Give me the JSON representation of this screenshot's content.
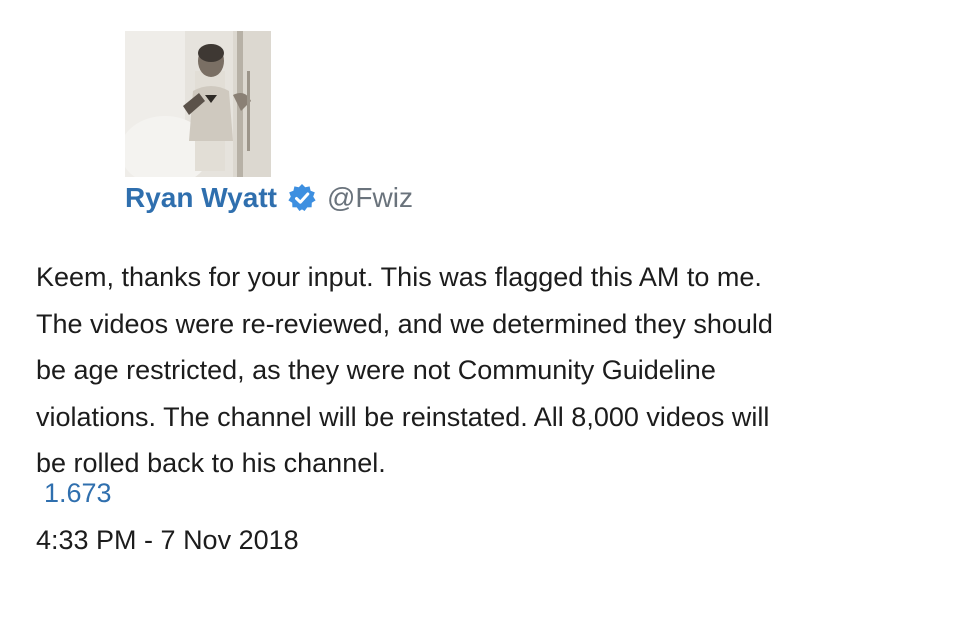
{
  "tweet": {
    "author": {
      "name": "Ryan Wyatt",
      "handle": "@Fwiz",
      "verified": true,
      "avatar_icon": "profile-photo",
      "verified_icon": "verified-badge-icon",
      "accent_color": "#2f6fae"
    },
    "lines": [
      "Keem, thanks for your input. This was flagged this AM to me.",
      "The videos were re-reviewed, and we determined they should",
      "be age restricted, as they were not Community Guideline",
      "violations. The channel will be reinstated. All 8,000 videos will",
      "be rolled back to his channel."
    ],
    "metric_value": "1.673",
    "timestamp": "4:33 PM - 7 Nov 2018"
  }
}
